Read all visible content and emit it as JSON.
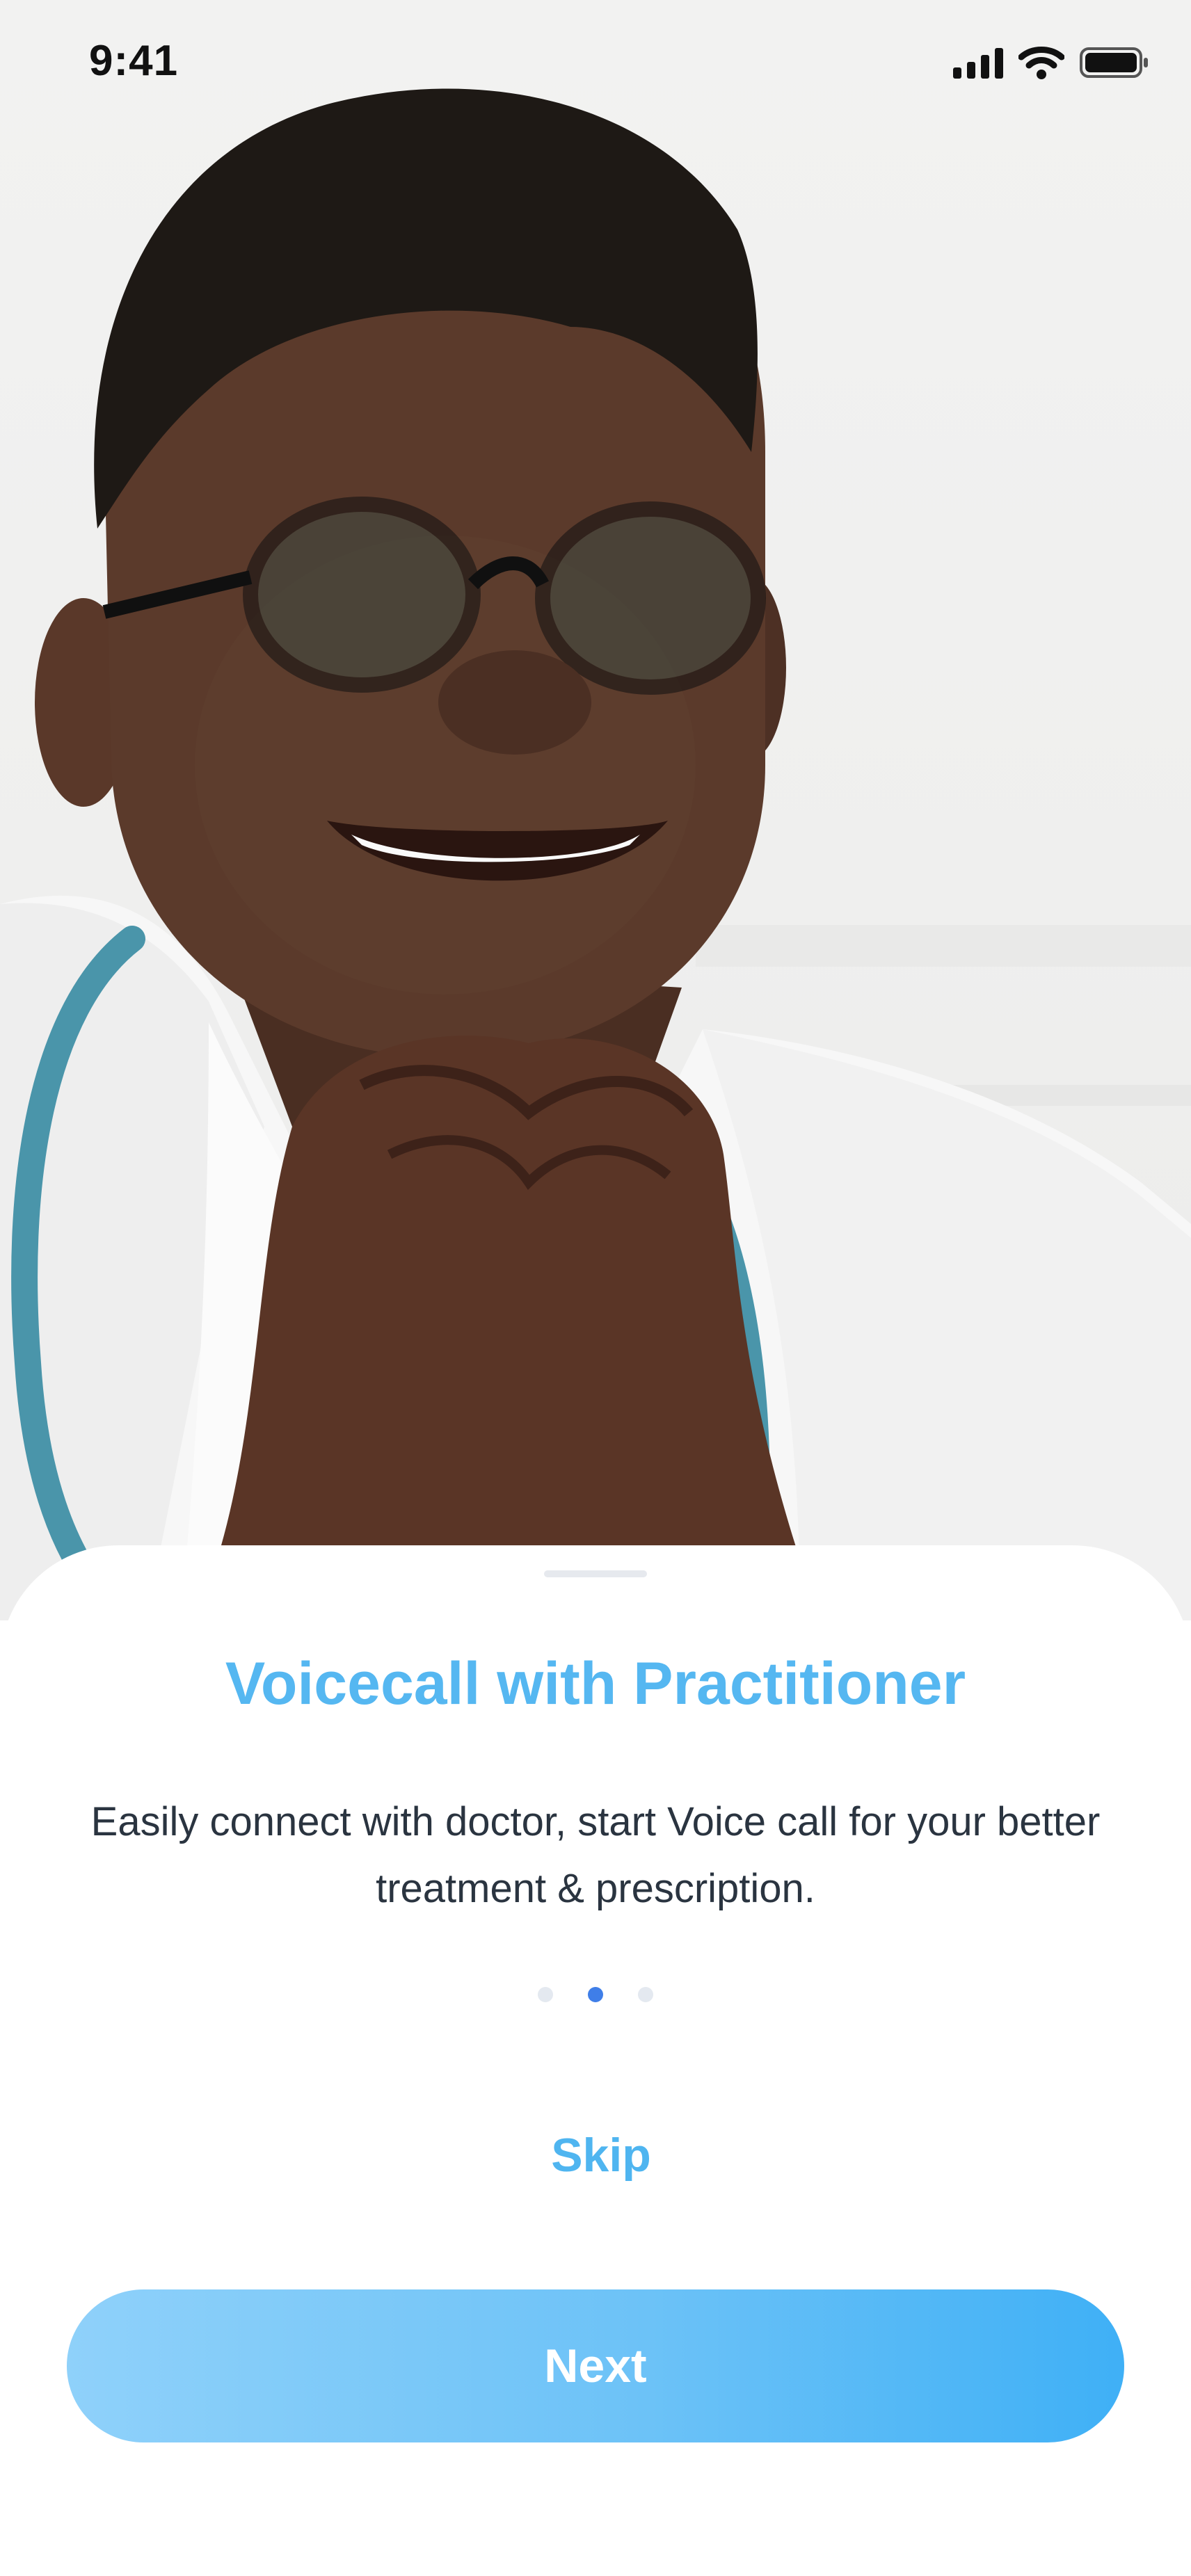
{
  "status_bar": {
    "time": "9:41",
    "icons": [
      "cellular-signal-icon",
      "wifi-icon",
      "battery-icon"
    ]
  },
  "hero": {
    "image_subject": "smiling-doctor-photo"
  },
  "onboarding": {
    "title": "Voicecall with Practitioner",
    "description": "Easily connect with doctor, start Voice call for your better treatment & prescription.",
    "pagination": {
      "total": 3,
      "active_index": 1
    },
    "skip_label": "Skip",
    "next_label": "Next"
  },
  "colors": {
    "title": "#55b7f1",
    "description": "#2a3440",
    "dot_active": "#3f7ee8",
    "dot_inactive": "#e4e9f0",
    "button_start": "#8fd1fa",
    "button_end": "#3fb0f6"
  }
}
